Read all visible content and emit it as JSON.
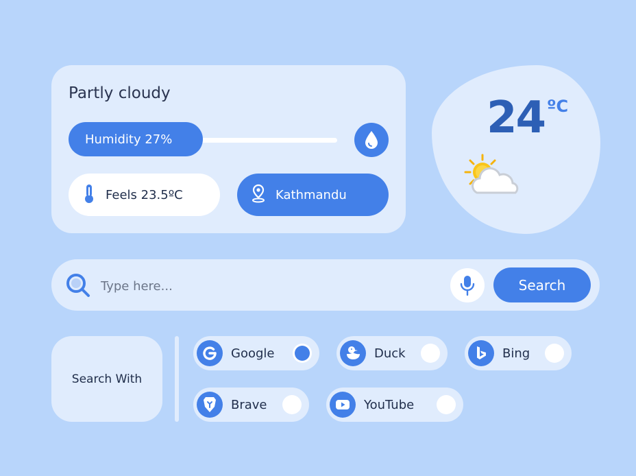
{
  "weather": {
    "condition": "Partly cloudy",
    "humidity_label": "Humidity 27%",
    "humidity_percent": 27,
    "feels_label": "Feels 23.5ºC",
    "location": "Kathmandu",
    "temperature": "24",
    "unit": "ºC"
  },
  "search": {
    "placeholder": "Type here...",
    "button_label": "Search"
  },
  "search_with": {
    "label": "Search With",
    "engines": [
      {
        "name": "Google",
        "selected": true
      },
      {
        "name": "Duck",
        "selected": false
      },
      {
        "name": "Bing",
        "selected": false
      },
      {
        "name": "Brave",
        "selected": false
      },
      {
        "name": "YouTube",
        "selected": false
      }
    ]
  },
  "colors": {
    "background": "#b8d5fb",
    "card": "#e0ecfd",
    "accent": "#4380e8"
  }
}
